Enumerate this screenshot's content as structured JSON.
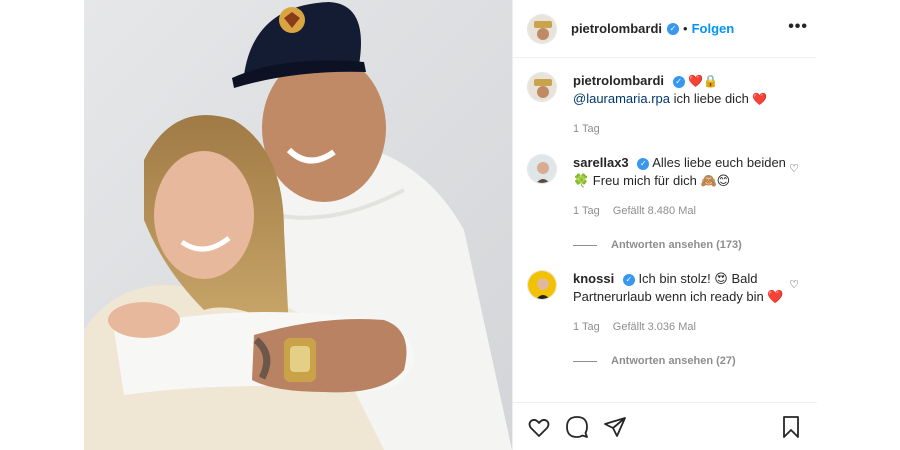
{
  "header": {
    "username": "pietrolombardi",
    "dot": "•",
    "follow_label": "Folgen",
    "more_label": "•••"
  },
  "caption": {
    "username": "pietrolombardi",
    "emoji": "❤️🔒",
    "mention": "@lauramaria.rpa",
    "text": "ich liebe dich",
    "heart": "❤️",
    "time": "1 Tag"
  },
  "comments": [
    {
      "username": "sarellax3",
      "text": "Alles liebe euch beiden 🍀 Freu mich für dich 🙈😊",
      "time": "1 Tag",
      "likes": "Gefällt 8.480 Mal",
      "replies": "Antworten ansehen (173)"
    },
    {
      "username": "knossi",
      "text": "Ich bin stolz! 😍 Bald Partnerurlaub wenn ich ready bin ❤️",
      "time": "1 Tag",
      "likes": "Gefällt 3.036 Mal",
      "replies": "Antworten ansehen (27)"
    }
  ],
  "icons": {
    "like": "heart-icon",
    "comment": "comment-icon",
    "share": "share-icon",
    "save": "bookmark-icon",
    "verified": "verified-badge-icon"
  },
  "colors": {
    "accent": "#0095f6",
    "verified": "#3897f0",
    "heart": "#ed4956",
    "muted": "#8e8e8e",
    "cap": "#141c33"
  }
}
